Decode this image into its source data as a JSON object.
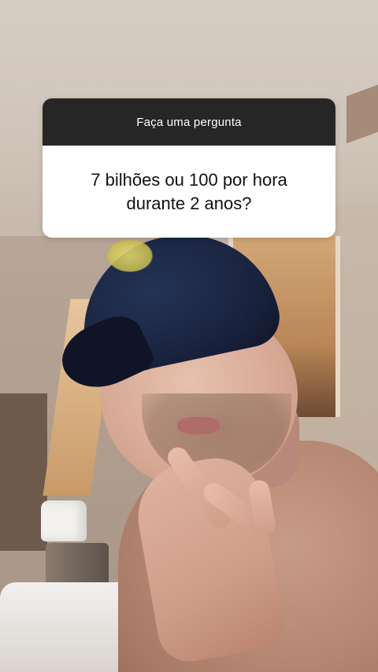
{
  "question_sticker": {
    "header": "Faça uma pergunta",
    "question": "7 bilhões ou 100 por hora\ndurante 2 anos?",
    "header_bg": "#262626",
    "body_bg": "#ffffff"
  },
  "background": {
    "description_icon": "video-frame-icon"
  }
}
